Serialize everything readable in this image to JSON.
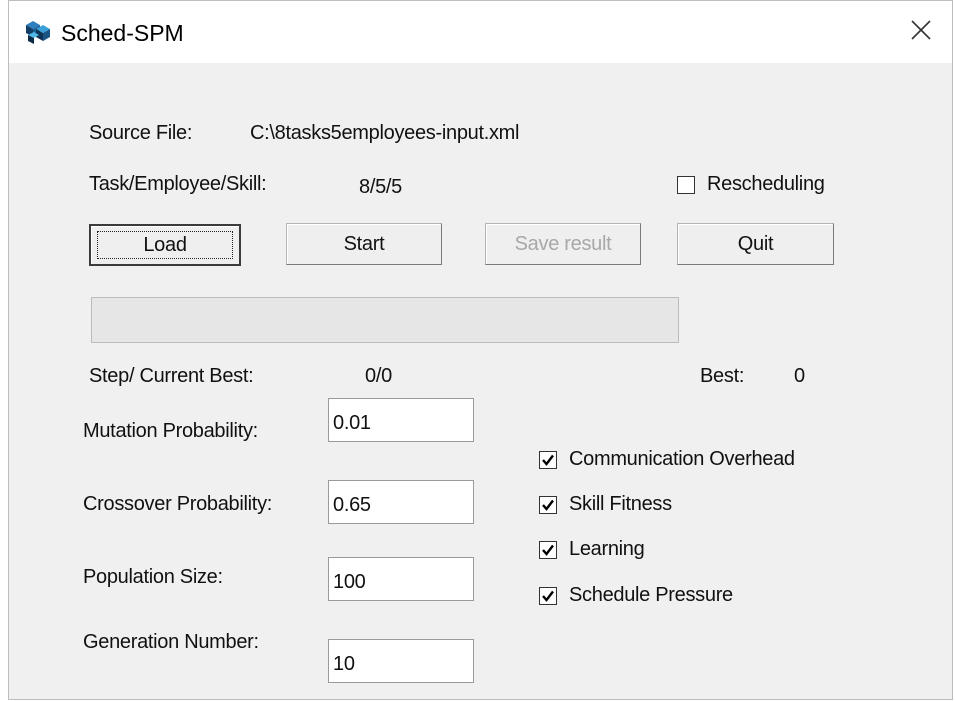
{
  "window": {
    "title": "Sched-SPM",
    "app_icon": "cube-icon",
    "close_icon": "close-icon"
  },
  "source_file": {
    "label": "Source File:",
    "value": "C:\\8tasks5employees-input.xml"
  },
  "task_employee_skill": {
    "label": "Task/Employee/Skill:",
    "value": "8/5/5"
  },
  "rescheduling": {
    "label": "Rescheduling",
    "checked": false
  },
  "buttons": {
    "load": "Load",
    "start": "Start",
    "save_result": "Save result",
    "quit": "Quit"
  },
  "progress": {
    "value": 0
  },
  "status": {
    "step_label": "Step/ Current Best:",
    "step_value": "0/0",
    "best_label": "Best:",
    "best_value": "0"
  },
  "params": {
    "mutation": {
      "label": "Mutation Probability:",
      "value": "0.01"
    },
    "crossover": {
      "label": "Crossover Probability:",
      "value": "0.65"
    },
    "population": {
      "label": "Population Size:",
      "value": "100"
    },
    "generation": {
      "label": "Generation Number:",
      "value": "10"
    }
  },
  "options": [
    {
      "label": "Communication Overhead",
      "checked": true
    },
    {
      "label": "Skill Fitness",
      "checked": true
    },
    {
      "label": "Learning",
      "checked": true
    },
    {
      "label": "Schedule Pressure",
      "checked": true
    }
  ],
  "colors": {
    "window_bg": "#f0f0f0",
    "titlebar_bg": "#ffffff",
    "progress_fill": "#06b025"
  }
}
